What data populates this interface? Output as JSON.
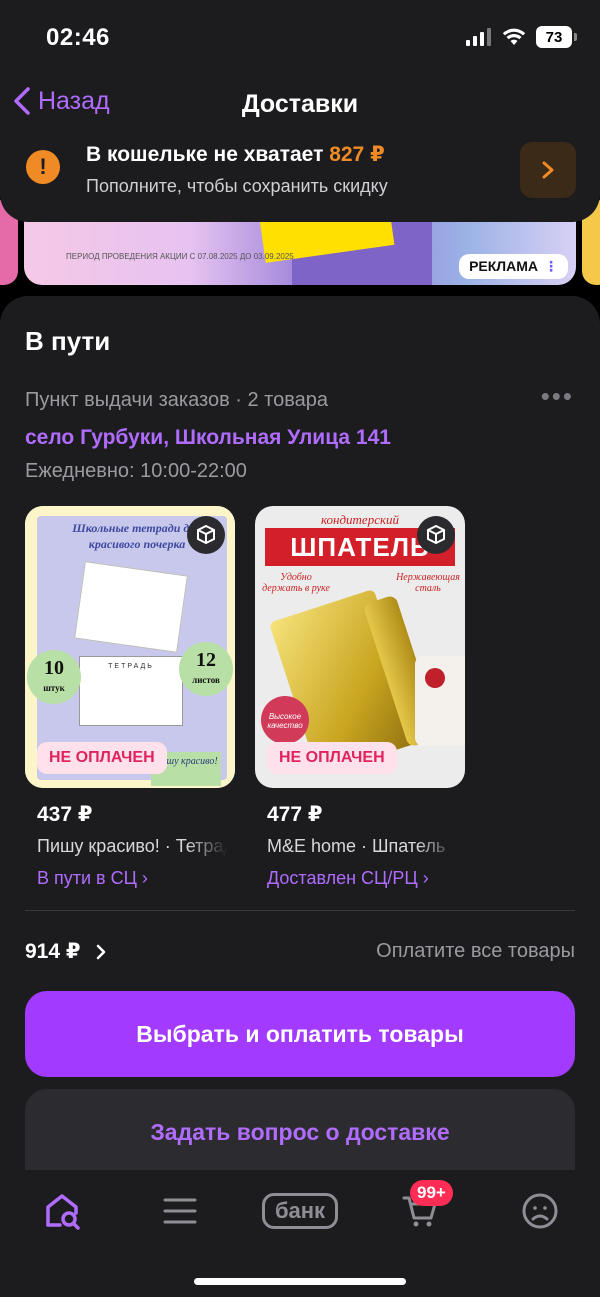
{
  "status_bar": {
    "time": "02:46",
    "battery": "73"
  },
  "nav": {
    "back_label": "Назад",
    "title": "Доставки"
  },
  "wallet": {
    "title_prefix": "В кошельке не хватает",
    "amount": "827 ₽",
    "subtitle": "Пополните, чтобы сохранить скидку"
  },
  "ad": {
    "label": "РЕКЛАМА",
    "promo_period": "ПЕРИОД ПРОВЕДЕНИЯ АКЦИИ С 07.08.2025 ДО 03.09.2025"
  },
  "delivery": {
    "section_title": "В пути",
    "pickup_meta": "Пункт выдачи заказов · 2 товара",
    "address": "село Гурбуки, Школьная Улица 141",
    "hours": "Ежедневно: 10:00-22:00",
    "products": [
      {
        "price": "437 ₽",
        "name": "Пишу красиво! · Тетради",
        "status": "В пути в СЦ ›",
        "unpaid": "НЕ ОПЛАЧЕН",
        "art": {
          "headline": "Школьные тетради для красивого почерка",
          "paper_label": "ТЕТРАДЬ",
          "badge_left_num": "10",
          "badge_left_unit": "штук",
          "badge_right_num": "12",
          "badge_right_unit": "листов",
          "tag": "Пишу красиво!"
        }
      },
      {
        "price": "477 ₽",
        "name": "M&E home · Шпатель",
        "status": "Доставлен СЦ/РЦ ›",
        "unpaid": "НЕ ОПЛАЧЕН",
        "art": {
          "top_script": "кондитерский",
          "banner": "ШПАТЕЛЬ",
          "left_note": "Удобно держать в руке",
          "right_note": "Нержавеющая сталь",
          "quality": "Высокое качество"
        }
      }
    ],
    "total": "914 ₽",
    "pay_all_hint": "Оплатите все товары",
    "primary_button": "Выбрать и оплатить товары",
    "secondary_button": "Задать вопрос о доставке"
  },
  "tabbar": {
    "bank_label": "банк",
    "cart_badge": "99+",
    "icons": [
      "home-search-icon",
      "catalog-icon",
      "bank-icon",
      "cart-icon",
      "profile-icon"
    ]
  },
  "colors": {
    "accent": "#a23bff",
    "accent_text": "#b06cff",
    "warning": "#f08a24",
    "card_bg": "#1c1c1f",
    "unpaid_text": "#e0245e"
  }
}
